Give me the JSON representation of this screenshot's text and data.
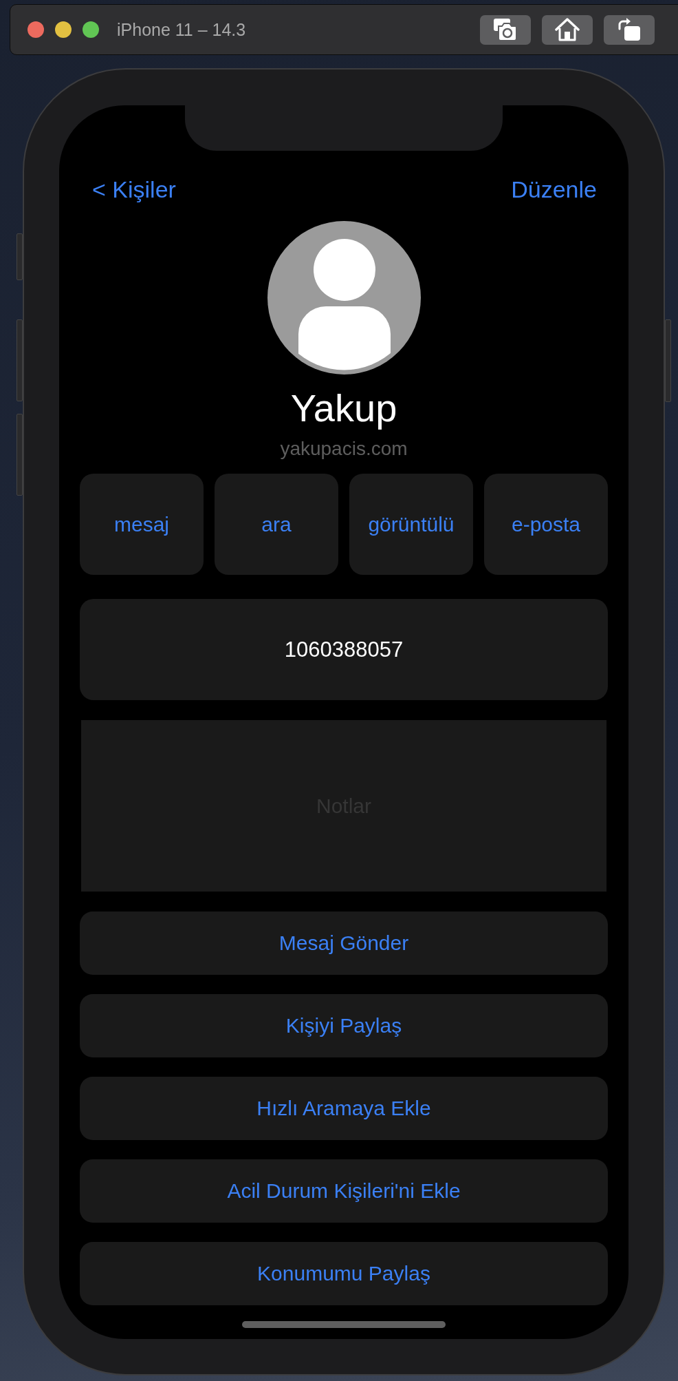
{
  "simulator": {
    "title": "iPhone 11 – 14.3"
  },
  "nav": {
    "back": "< Kişiler",
    "edit": "Düzenle"
  },
  "contact": {
    "name": "Yakup",
    "subtitle": "yakupacis.com"
  },
  "actions": [
    "mesaj",
    "ara",
    "görüntülü",
    "e-posta"
  ],
  "phone": "1060388057",
  "notes": {
    "placeholder": "Notlar"
  },
  "buttons": [
    "Mesaj Gönder",
    "Kişiyi Paylaş",
    "Hızlı Aramaya Ekle",
    "Acil Durum Kişileri'ni Ekle",
    "Konumumu Paylaş"
  ]
}
